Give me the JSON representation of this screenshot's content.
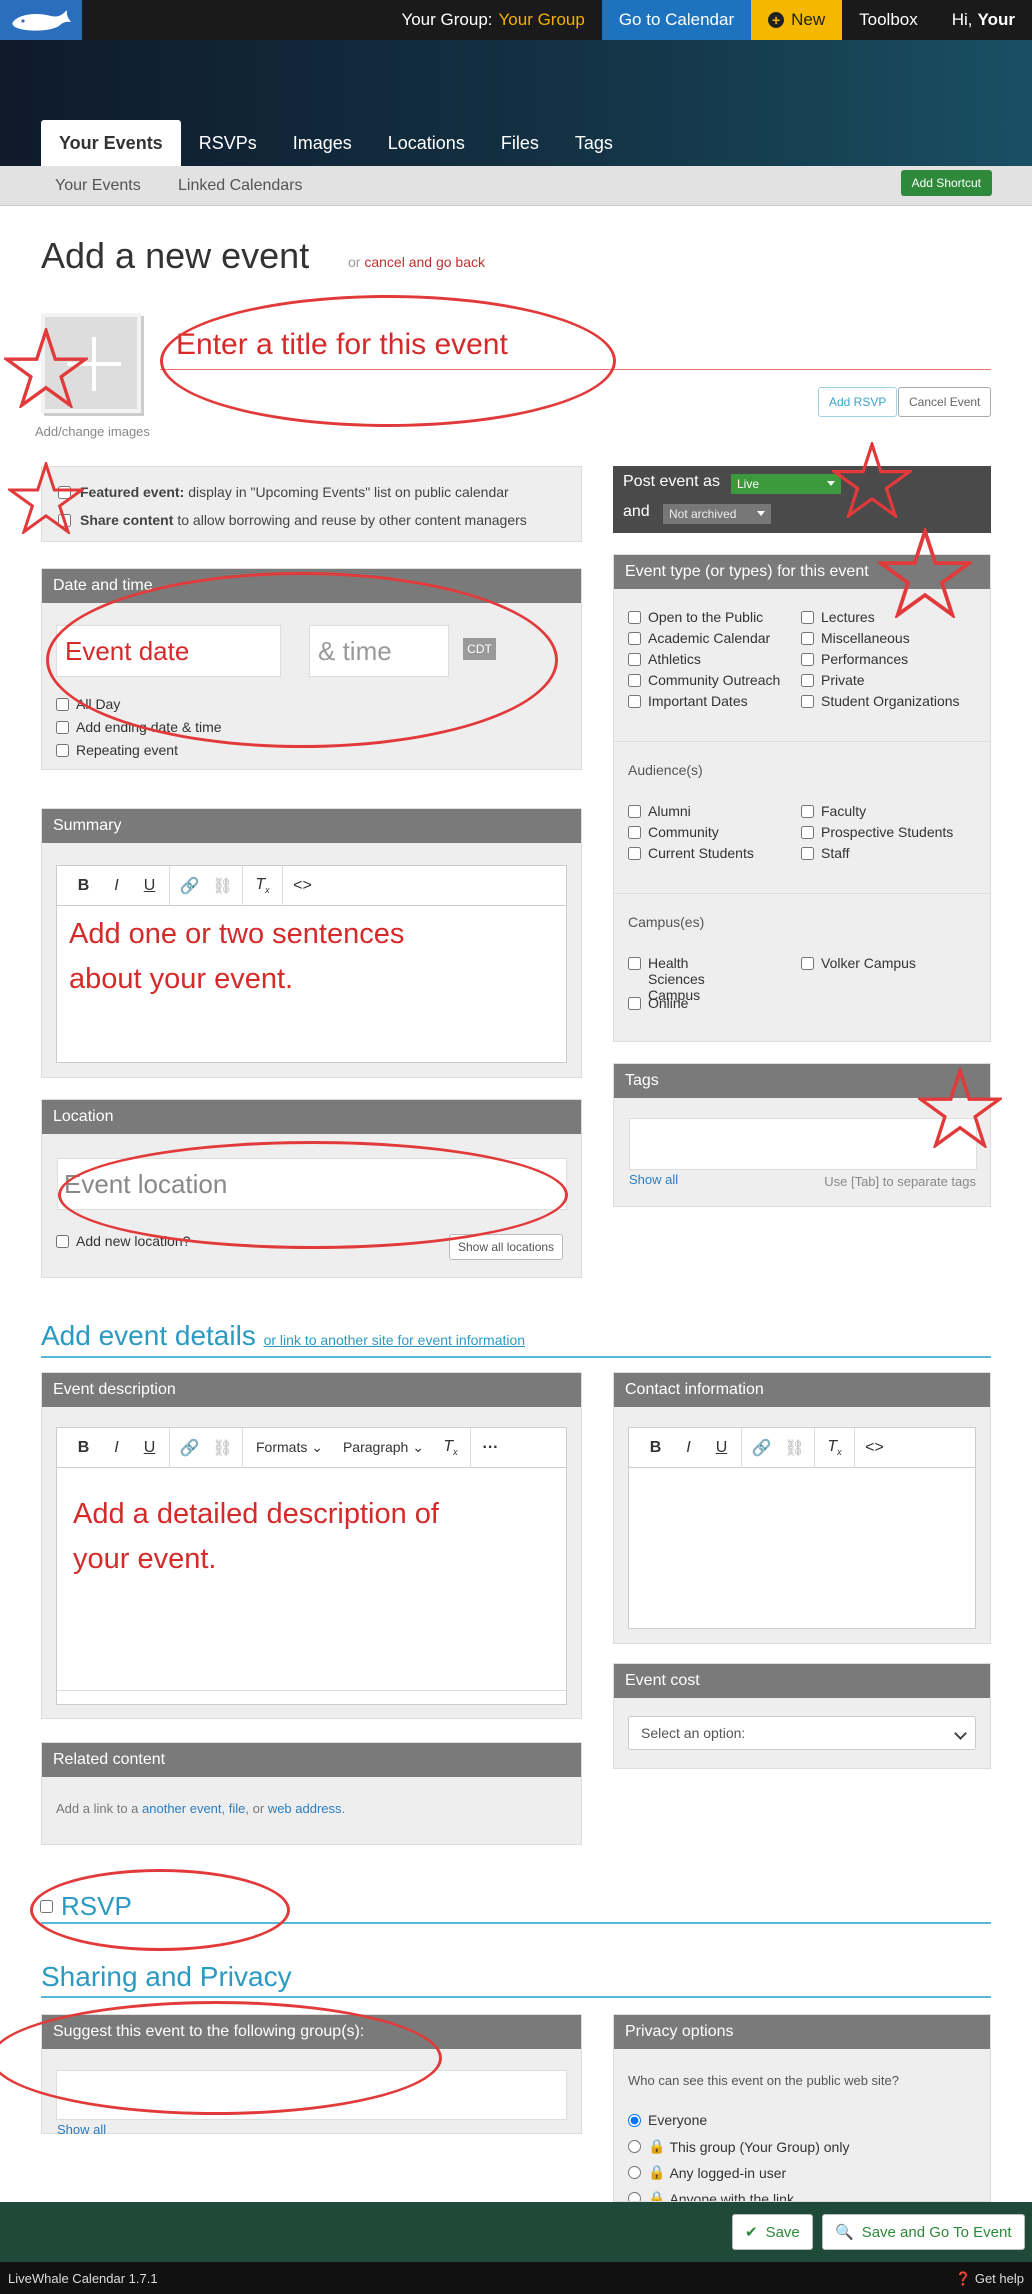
{
  "topbar": {
    "group_label": "Your Group:",
    "group_name": "Your Group",
    "calendar_label": "Go to Calendar",
    "new_label": "New",
    "toolbox_label": "Toolbox",
    "hi_label": "Hi,",
    "hi_name": "Your"
  },
  "tabs": [
    "Your Events",
    "RSVPs",
    "Images",
    "Locations",
    "Files",
    "Tags"
  ],
  "subnav": {
    "items": [
      "Your Events",
      "Linked Calendars"
    ],
    "shortcut_label": "Add Shortcut"
  },
  "page": {
    "title": "Add a new event",
    "or_text": "or",
    "cancel_link": "cancel and go back",
    "image_label": "Add/change images",
    "title_placeholder": "Enter a title for this event",
    "add_rsvp": "Add RSVP",
    "cancel_event": "Cancel Event"
  },
  "feature": {
    "featured_bold": "Featured event:",
    "featured_text": "display in \"Upcoming Events\" list on public calendar",
    "share_bold": "Share content",
    "share_text": "to allow borrowing and reuse by other content managers"
  },
  "post": {
    "label": "Post event as",
    "status": "Live",
    "and_label": "and",
    "archive": "Not archived"
  },
  "datetime": {
    "heading": "Date and time",
    "date_placeholder": "Event date",
    "time_placeholder": "& time",
    "tz": "CDT",
    "options": [
      "All Day",
      "Add ending date & time",
      "Repeating event"
    ]
  },
  "summary": {
    "heading": "Summary",
    "placeholder_line1": "Add one or two sentences",
    "placeholder_line2": "about your event."
  },
  "location": {
    "heading": "Location",
    "placeholder": "Event location",
    "add_new": "Add new location?",
    "show_all": "Show all locations"
  },
  "event_types": {
    "heading": "Event type (or types) for this event",
    "col1": [
      "Open to the Public",
      "Academic Calendar",
      "Athletics",
      "Community Outreach",
      "Important Dates"
    ],
    "col2": [
      "Lectures",
      "Miscellaneous",
      "Performances",
      "Private",
      "Student Organizations"
    ],
    "audience_heading": "Audience(s)",
    "aud_col1": [
      "Alumni",
      "Community",
      "Current Students"
    ],
    "aud_col2": [
      "Faculty",
      "Prospective Students",
      "Staff"
    ],
    "campus_heading": "Campus(es)",
    "campus_col1": [
      "Health Sciences Campus",
      "Online"
    ],
    "campus_col2": [
      "Volker Campus"
    ]
  },
  "tags": {
    "heading": "Tags",
    "show_all": "Show all",
    "hint": "Use [Tab] to separate tags"
  },
  "details": {
    "title": "Add event details",
    "sub": "or link to another site for event information",
    "desc_heading": "Event description",
    "formats": "Formats",
    "paragraph": "Paragraph",
    "desc_line1": "Add a detailed description of",
    "desc_line2": "your event.",
    "contact_heading": "Contact information",
    "cost_heading": "Event cost",
    "cost_select": "Select an option:",
    "related_heading": "Related content",
    "related_pre": "Add a link to a",
    "related_event": "another event",
    "related_file": "file",
    "related_or": "or",
    "related_web": "web address"
  },
  "rsvp": {
    "title": "RSVP"
  },
  "sharing": {
    "title": "Sharing and Privacy",
    "suggest_heading": "Suggest this event to the following group(s):",
    "show_all": "Show all",
    "privacy_heading": "Privacy options",
    "privacy_question": "Who can see this event on the public web site?",
    "options": [
      "Everyone",
      "This group (Your Group) only",
      "Any logged-in user",
      "Anyone with the link"
    ]
  },
  "actions": {
    "save": "Save",
    "save_go": "Save and Go To Event"
  },
  "footer": {
    "version": "LiveWhale Calendar 1.7.1",
    "help": "Get help"
  }
}
